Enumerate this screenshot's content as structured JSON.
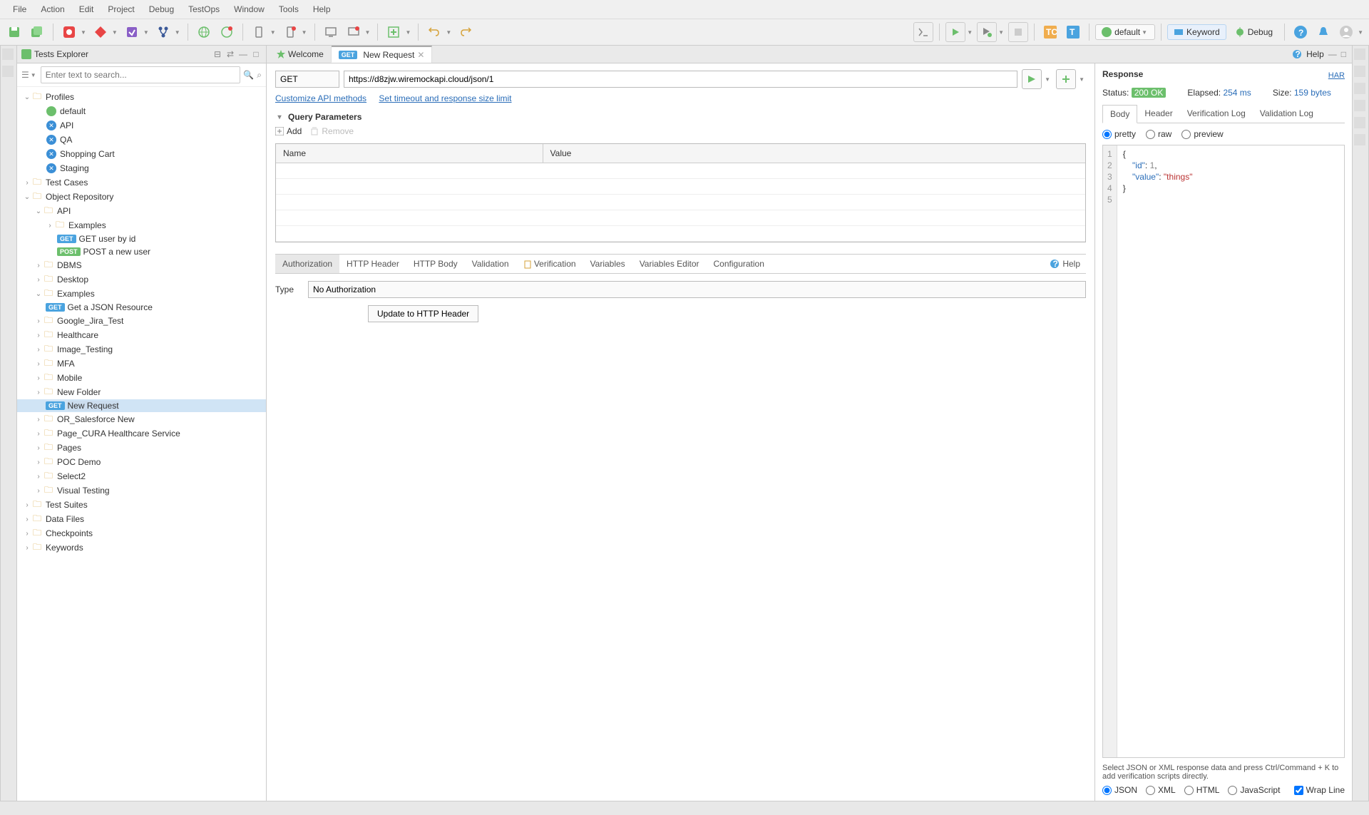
{
  "menubar": [
    "File",
    "Action",
    "Edit",
    "Project",
    "Debug",
    "TestOps",
    "Window",
    "Tools",
    "Help"
  ],
  "toolbar": {
    "default_label": "default",
    "keyword_label": "Keyword",
    "debug_label": "Debug"
  },
  "explorer": {
    "title": "Tests Explorer",
    "search_placeholder": "Enter text to search...",
    "tree": {
      "profiles": {
        "label": "Profiles",
        "items": [
          "default",
          "API",
          "QA",
          "Shopping Cart",
          "Staging"
        ]
      },
      "test_cases": "Test Cases",
      "object_repo": {
        "label": "Object Repository",
        "api": {
          "label": "API",
          "examples": "Examples",
          "get_user": "GET user by id",
          "post_user": "POST a new user"
        },
        "folders": [
          "DBMS",
          "Desktop"
        ],
        "examples2": {
          "label": "Examples",
          "get_json": "Get a JSON Resource"
        },
        "folders2": [
          "Google_Jira_Test",
          "Healthcare",
          "Image_Testing",
          "MFA",
          "Mobile",
          "New Folder"
        ],
        "new_request": "New Request",
        "folders3": [
          "OR_Salesforce New",
          "Page_CURA Healthcare Service",
          "Pages",
          "POC Demo",
          "Select2",
          "Visual Testing"
        ]
      },
      "test_suites": "Test Suites",
      "data_files": "Data Files",
      "checkpoints": "Checkpoints",
      "keywords": "Keywords"
    }
  },
  "tabs": {
    "welcome": "Welcome",
    "new_request": "New Request",
    "help": "Help"
  },
  "request": {
    "method": "GET",
    "url": "https://d8zjw.wiremockapi.cloud/json/1",
    "link_customize": "Customize API methods",
    "link_timeout": "Set timeout and response size limit",
    "section_qp": "Query Parameters",
    "add_label": "Add",
    "remove_label": "Remove",
    "table_headers": [
      "Name",
      "Value"
    ],
    "bottom_tabs": [
      "Authorization",
      "HTTP Header",
      "HTTP Body",
      "Validation",
      "Verification",
      "Variables",
      "Variables Editor",
      "Configuration"
    ],
    "help_label": "Help",
    "auth_type_label": "Type",
    "auth_type_value": "No Authorization",
    "update_btn": "Update to HTTP Header"
  },
  "response": {
    "title": "Response",
    "har": "HAR",
    "status_label": "Status:",
    "status_value": "200 OK",
    "elapsed_label": "Elapsed:",
    "elapsed_value": "254 ms",
    "size_label": "Size:",
    "size_value": "159 bytes",
    "tabs": [
      "Body",
      "Header",
      "Verification Log",
      "Validation Log"
    ],
    "formats": [
      "pretty",
      "raw",
      "preview"
    ],
    "body_lines": [
      "{",
      "    \"id\": 1,",
      "    \"value\": \"things\"",
      "}",
      ""
    ],
    "hint": "Select JSON or XML response data and press Ctrl/Command + K to add verification scripts directly.",
    "langs": [
      "JSON",
      "XML",
      "HTML",
      "JavaScript"
    ],
    "wrap": "Wrap Line"
  }
}
